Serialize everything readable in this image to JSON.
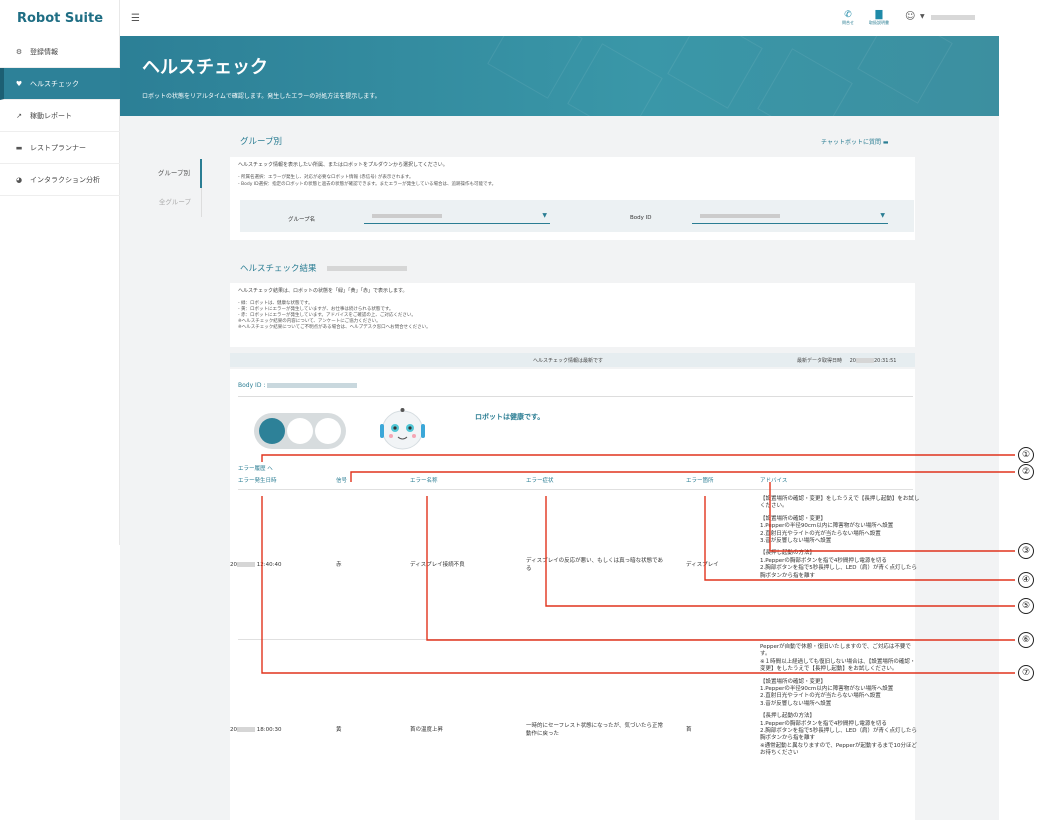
{
  "app": {
    "logo": "Robot Suite"
  },
  "sidebar": {
    "items": [
      {
        "label": "登録情報",
        "icon": "gears-icon"
      },
      {
        "label": "ヘルスチェック",
        "icon": "heartbeat-icon"
      },
      {
        "label": "稼動レポート",
        "icon": "line-chart-icon"
      },
      {
        "label": "レストプランナー",
        "icon": "bed-icon"
      },
      {
        "label": "インタラクション分析",
        "icon": "pie-chart-icon"
      }
    ]
  },
  "topbar": {
    "contact_label": "問合せ",
    "manual_label": "取扱説明書"
  },
  "hero": {
    "title": "ヘルスチェック",
    "subtitle": "ロボットの状態をリアルタイムで確認します。発生したエラーの対処方法を提示します。"
  },
  "group": {
    "section_title": "グループ別",
    "chatbot_link": "チャットボットに質問",
    "tabs": [
      "グループ別",
      "全グループ"
    ],
    "intro": "ヘルスチェック情報を表示したい所属、またはロボットをプルダウンから選択してください。",
    "note1": "- 所属名選択：エラーが発生し、対応が必要なロボット情報 (赤信号) が表示されます。",
    "note2": "- Body ID選択：指定のロボットの状態と過去の状態が確認できます。またエラーが発生している場合は、追跡操作も可能です。",
    "group_label": "グループ名",
    "body_label": "Body ID"
  },
  "results": {
    "section_title": "ヘルスチェック結果",
    "intro": "ヘルスチェック結果は、ロボットの状態を「緑」「黄」「赤」で表示します。",
    "notes": [
      "- 緑：ロボットは、健康な状態です。",
      "- 黄：ロボットにエラーが発生していますが、お仕事は続けられる状態です。",
      "- 赤：ロボットにエラーが発生しています。アドバイスをご確認の上、ご対応ください。",
      "※ヘルスチェック結果の内容について、アンケートにご協力ください。",
      "※ヘルスチェック結果についてご不明点がある場合は、ヘルプデスク窓口へお問合せください。"
    ],
    "status_center": "ヘルスチェック情報は最新です",
    "status_right_label": "最新データ取得日時",
    "status_right_prefix": "20",
    "status_right_time": "20:31:51",
    "body_id_label": "Body ID :",
    "robot_message": "ロボットは健康です。",
    "error_history_link": "エラー履歴 へ",
    "headers": [
      "エラー発生日時",
      "信号",
      "エラー名称",
      "エラー症状",
      "エラー箇所",
      "アドバイス"
    ],
    "rows": [
      {
        "date_prefix": "20",
        "time": "12:40:40",
        "signal": "赤",
        "name": "ディスプレイ接続不良",
        "symptom": "ディスプレイの反応が悪い、もしくは真っ暗な状態である",
        "location": "ディスプレイ",
        "advice": [
          "【設置場所の確認・変更】をしたうえで【長押し起動】をお試しください。",
          "",
          "【設置場所の確認・変更】",
          "1.Pepperの半径90cm以内に障害物がない場所へ設置",
          "2.直射日光やライトの光が当たらない場所へ設置",
          "3.音が反響しない場所へ設置",
          "",
          "【長押し起動の方法】",
          "1.Pepperの胸部ボタンを指で4秒間押し電源を切る",
          "2.胸部ボタンを指で5秒長押しし、LED（肩）が青く点灯したら胸ボタンから指を離す"
        ]
      },
      {
        "date_prefix": "20",
        "time": "18:00:30",
        "signal": "黄",
        "name": "首の温度上昇",
        "symptom": "一時的にセーフレスト状態になったが、気づいたら正常動作に戻った",
        "location": "首",
        "advice": [
          "Pepperが自動で休憩・復旧いたしますので、ご対応は不要です。",
          "※１時間以上経過しても復旧しない場合は、【設置場所の確認・変更】をしたうえで【長押し起動】をお試しください。",
          "",
          "【設置場所の確認・変更】",
          "1.Pepperの半径90cm以内に障害物がない場所へ設置",
          "2.直射日光やライトの光が当たらない場所へ設置",
          "3.音が反響しない場所へ設置",
          "",
          "【長押し起動の方法】",
          "1.Pepperの胸部ボタンを指で4秒間押し電源を切る",
          "2.胸部ボタンを指で5秒長押しし、LED（肩）が青く点灯したら胸ボタンから指を離す",
          "※通常起動と異なりますので、Pepperが起動するまで10分ほどお待ちください"
        ]
      }
    ]
  },
  "callouts": [
    "①",
    "②",
    "③",
    "④",
    "⑤",
    "⑥",
    "⑦"
  ],
  "colors": {
    "accent": "#2d8198",
    "callout_line": "#e0331d"
  }
}
